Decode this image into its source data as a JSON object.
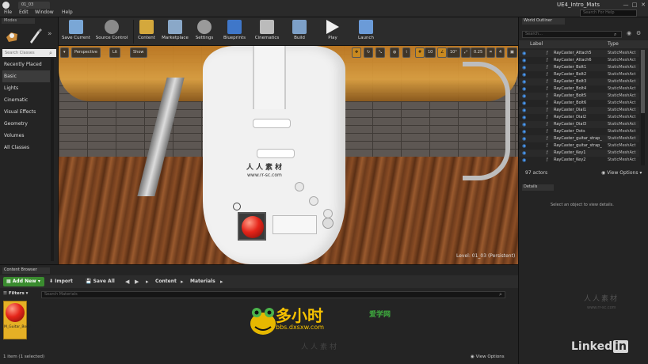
{
  "window": {
    "level_tab": "01_03",
    "project_name": "UE4_Intro_Mats",
    "search_help_placeholder": "Search For Help",
    "menu": [
      "File",
      "Edit",
      "Window",
      "Help"
    ],
    "controls": {
      "minimize": "—",
      "maximize": "□",
      "close": "✕"
    }
  },
  "modes": {
    "tab_label": "Modes",
    "search_placeholder": "Search Classes",
    "categories": [
      "Recently Placed",
      "Basic",
      "Lights",
      "Cinematic",
      "Visual Effects",
      "Geometry",
      "Volumes",
      "All Classes"
    ],
    "active_category": "Basic"
  },
  "toolbar": {
    "buttons": [
      {
        "label": "Save Current",
        "icon": "save-icon",
        "color": "#7aa7d6"
      },
      {
        "label": "Source Control",
        "icon": "source-control-icon",
        "color": "#8a8a8a"
      },
      {
        "label": "Content",
        "icon": "content-icon",
        "color": "#d4a83c"
      },
      {
        "label": "Marketplace",
        "icon": "marketplace-icon",
        "color": "#8aa8c8"
      },
      {
        "label": "Settings",
        "icon": "gear-icon",
        "color": "#9a9a9a"
      },
      {
        "label": "Blueprints",
        "icon": "blueprints-icon",
        "color": "#3f77c9"
      },
      {
        "label": "Cinematics",
        "icon": "clapper-icon",
        "color": "#bbbbbb"
      },
      {
        "label": "Build",
        "icon": "build-icon",
        "color": "#7da0c8"
      },
      {
        "label": "Play",
        "icon": "play-icon",
        "color": "#f0f0f0"
      },
      {
        "label": "Launch",
        "icon": "launch-icon",
        "color": "#6b9bd8"
      }
    ]
  },
  "viewport": {
    "perspective_label": "Perspective",
    "lit_label": "Lit",
    "show_label": "Show",
    "grid_snap": "10",
    "rotation_snap": "10°",
    "scale_snap": "0.25",
    "camera_speed": "4",
    "level_readout": "Level:  01_03 (Persistent)",
    "watermark_cn": "人人素材",
    "watermark_url": "www.rr-sc.com"
  },
  "world_outliner": {
    "tab_label": "World Outliner",
    "search_placeholder": "Search...",
    "col_label": "Label",
    "col_type": "Type",
    "rows": [
      {
        "name": "RayCaster_Attach5",
        "type": "StaticMeshAct"
      },
      {
        "name": "RayCaster_Attach6",
        "type": "StaticMeshAct"
      },
      {
        "name": "RayCaster_Bolt1",
        "type": "StaticMeshAct"
      },
      {
        "name": "RayCaster_Bolt2",
        "type": "StaticMeshAct"
      },
      {
        "name": "RayCaster_Bolt3",
        "type": "StaticMeshAct"
      },
      {
        "name": "RayCaster_Bolt4",
        "type": "StaticMeshAct"
      },
      {
        "name": "RayCaster_Bolt5",
        "type": "StaticMeshAct"
      },
      {
        "name": "RayCaster_Bolt6",
        "type": "StaticMeshAct"
      },
      {
        "name": "RayCaster_Dial1",
        "type": "StaticMeshAct"
      },
      {
        "name": "RayCaster_Dial2",
        "type": "StaticMeshAct"
      },
      {
        "name": "RayCaster_Dial3",
        "type": "StaticMeshAct"
      },
      {
        "name": "RayCaster_Dots",
        "type": "StaticMeshAct"
      },
      {
        "name": "RayCaster_guitar_strap_",
        "type": "StaticMeshAct"
      },
      {
        "name": "RayCaster_guitar_strap_",
        "type": "StaticMeshAct"
      },
      {
        "name": "RayCaster_Key1",
        "type": "StaticMeshAct"
      },
      {
        "name": "RayCaster_Key2",
        "type": "StaticMeshAct"
      }
    ],
    "actor_count": "97 actors",
    "view_options": "View Options"
  },
  "details": {
    "tab_label": "Details",
    "empty_message": "Select an object to view details.",
    "watermark_cn": "人人素材",
    "watermark_url": "www.rr-sc.com",
    "brand": "Linked",
    "brand_in": "in"
  },
  "content_browser": {
    "tab_label": "Content Browser",
    "add_new": "Add New",
    "import": "Import",
    "save_all": "Save All",
    "crumb_root": "Content",
    "crumb_child": "Materials",
    "filters": "Filters",
    "search_placeholder": "Search Materials",
    "asset_label": "M_Guitar_Body",
    "status": "1 item (1 selected)",
    "view_options": "View Options",
    "site_logo": "多小时",
    "site_logo_sub": "爱学网",
    "site_url": "bbs.dxsxw.com",
    "watermark_cn": "人人素材"
  }
}
